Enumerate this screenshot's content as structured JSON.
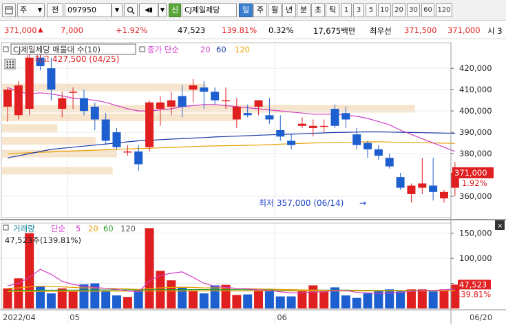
{
  "toolbar": {
    "interval_label": "주",
    "prev_label": "전",
    "stock_code": "097950",
    "badge_label": "신",
    "stock_name": "CJ제일제당",
    "period_tabs": [
      "일",
      "주",
      "월",
      "년",
      "분",
      "초",
      "틱"
    ],
    "active_period": "일",
    "period_numbers": [
      "1",
      "3",
      "5",
      "10",
      "20",
      "30",
      "60",
      "120"
    ]
  },
  "quote": {
    "price": "371,000",
    "arrow": "▲",
    "change": "7,000",
    "change_pct": "+1.92%",
    "volume": "47,523",
    "volume_ratio": "139.81%",
    "turnover_pct": "0.32%",
    "amount": "17,675백만",
    "best_ask_label": "최우선",
    "best_ask": "371,500",
    "best_bid": "371,000",
    "trailing": "시 3"
  },
  "price_panel": {
    "indicator_name": "CJ제일제당 매물대 수(10)",
    "ma_label": "종가 단순",
    "ma_periods": [
      "20",
      "60",
      "120"
    ],
    "high_annotation": "←최고 427,500 (04/25)",
    "low_annotation": "최저 357,000 (06/14)",
    "low_arrow": "→",
    "price_tag": "371,000",
    "pct_tag": "1.92%",
    "y_ticks": [
      "420,000",
      "410,000",
      "400,000",
      "390,000",
      "380,000",
      "360,000"
    ]
  },
  "volume_panel": {
    "title": "거래량",
    "ma_label": "단순",
    "ma_periods": [
      "5",
      "20",
      "60",
      "120"
    ],
    "readout": "47,523주(139.81%)",
    "y_ticks": [
      "150,000",
      "100,000",
      "50,000"
    ],
    "tag_volume": "47,523",
    "tag_pct": "139.81%"
  },
  "x_axis": {
    "labels": [
      "2022/04",
      "05",
      "06",
      "06/20"
    ]
  },
  "colors": {
    "up": "#e02020",
    "down": "#1e5fd0",
    "ma20": "#d23cc8",
    "ma60": "#1e3aa8",
    "ma120": "#e8a000",
    "volume_profile": "#f7e4cc"
  },
  "chart_data": {
    "type": "candlestick",
    "price_range": [
      350000,
      432000
    ],
    "candles": [
      {
        "o": 402000,
        "h": 411000,
        "l": 395000,
        "c": 410000
      },
      {
        "o": 398000,
        "h": 414000,
        "l": 396000,
        "c": 412000
      },
      {
        "o": 401000,
        "h": 427500,
        "l": 398000,
        "c": 425000
      },
      {
        "o": 425000,
        "h": 427000,
        "l": 419000,
        "c": 421000
      },
      {
        "o": 420000,
        "h": 425000,
        "l": 405000,
        "c": 410000
      },
      {
        "o": 401000,
        "h": 409000,
        "l": 397000,
        "c": 406000
      },
      {
        "o": 409000,
        "h": 411000,
        "l": 401000,
        "c": 409000
      },
      {
        "o": 406000,
        "h": 410000,
        "l": 398000,
        "c": 400000
      },
      {
        "o": 402000,
        "h": 404000,
        "l": 391000,
        "c": 396000
      },
      {
        "o": 396000,
        "h": 399000,
        "l": 384000,
        "c": 386000
      },
      {
        "o": 390000,
        "h": 392000,
        "l": 382000,
        "c": 383000
      },
      {
        "o": 381000,
        "h": 384000,
        "l": 379000,
        "c": 381000
      },
      {
        "o": 381000,
        "h": 384000,
        "l": 372000,
        "c": 375000
      },
      {
        "o": 383000,
        "h": 405000,
        "l": 381000,
        "c": 404000
      },
      {
        "o": 401000,
        "h": 407000,
        "l": 393000,
        "c": 404000
      },
      {
        "o": 402000,
        "h": 409000,
        "l": 398000,
        "c": 405000
      },
      {
        "o": 407000,
        "h": 412000,
        "l": 397000,
        "c": 402000
      },
      {
        "o": 410000,
        "h": 415000,
        "l": 404000,
        "c": 412000
      },
      {
        "o": 411000,
        "h": 414000,
        "l": 401000,
        "c": 409000
      },
      {
        "o": 409000,
        "h": 411000,
        "l": 403000,
        "c": 405000
      },
      {
        "o": 405000,
        "h": 411000,
        "l": 401000,
        "c": 405000
      },
      {
        "o": 396000,
        "h": 406000,
        "l": 392000,
        "c": 402000
      },
      {
        "o": 399000,
        "h": 403000,
        "l": 397000,
        "c": 398000
      },
      {
        "o": 402000,
        "h": 405000,
        "l": 398000,
        "c": 405000
      },
      {
        "o": 398000,
        "h": 406000,
        "l": 394000,
        "c": 396000
      },
      {
        "o": 391000,
        "h": 398000,
        "l": 386000,
        "c": 388000
      },
      {
        "o": 386000,
        "h": 389000,
        "l": 382000,
        "c": 384000
      },
      {
        "o": 393000,
        "h": 397000,
        "l": 392000,
        "c": 394000
      },
      {
        "o": 392000,
        "h": 396000,
        "l": 388000,
        "c": 393000
      },
      {
        "o": 393000,
        "h": 396000,
        "l": 390000,
        "c": 393000
      },
      {
        "o": 401000,
        "h": 403000,
        "l": 392000,
        "c": 393000
      },
      {
        "o": 399000,
        "h": 402000,
        "l": 392000,
        "c": 396000
      },
      {
        "o": 389000,
        "h": 392000,
        "l": 382000,
        "c": 384000
      },
      {
        "o": 385000,
        "h": 386000,
        "l": 378000,
        "c": 382000
      },
      {
        "o": 382000,
        "h": 384000,
        "l": 377000,
        "c": 379000
      },
      {
        "o": 378000,
        "h": 380000,
        "l": 373000,
        "c": 374000
      },
      {
        "o": 369000,
        "h": 371000,
        "l": 363000,
        "c": 364000
      },
      {
        "o": 361000,
        "h": 366000,
        "l": 357000,
        "c": 365000
      },
      {
        "o": 364000,
        "h": 378000,
        "l": 361000,
        "c": 366000
      },
      {
        "o": 365000,
        "h": 378000,
        "l": 358000,
        "c": 362000
      },
      {
        "o": 359000,
        "h": 363000,
        "l": 357000,
        "c": 362000
      },
      {
        "o": 364000,
        "h": 376000,
        "l": 360000,
        "c": 371000
      }
    ],
    "ma20": [
      411000,
      409000,
      408000,
      408500,
      408000,
      407000,
      406000,
      405500,
      405000,
      404000,
      402500,
      401000,
      400000,
      400000,
      400500,
      401000,
      402000,
      402500,
      403000,
      403000,
      402500,
      402000,
      401500,
      401000,
      400500,
      400000,
      399500,
      399000,
      398500,
      398500,
      398500,
      398000,
      397500,
      396500,
      395000,
      393500,
      391000,
      389000,
      387000,
      385000,
      383000,
      381000
    ],
    "ma60": [
      378000,
      379000,
      380000,
      381000,
      382000,
      382500,
      383000,
      383500,
      384000,
      384500,
      385000,
      385500,
      386000,
      386200,
      386500,
      386800,
      387000,
      387300,
      387500,
      387800,
      388000,
      388200,
      388400,
      388600,
      388800,
      389000,
      389100,
      389300,
      389500,
      389700,
      389900,
      390000,
      390100,
      390200,
      390200,
      390100,
      390000,
      389900,
      389800,
      389700,
      389600,
      389500
    ],
    "ma120": [
      380000,
      380200,
      380400,
      380600,
      380800,
      381000,
      381200,
      381400,
      381600,
      381800,
      382000,
      382200,
      382400,
      382500,
      382700,
      382900,
      383100,
      383300,
      383500,
      383600,
      383700,
      383800,
      383900,
      384000,
      384200,
      384400,
      384600,
      384800,
      385000,
      385100,
      385200,
      385300,
      385400,
      385500,
      385500,
      385400,
      385300,
      385200,
      385100,
      385000,
      384900,
      384800
    ],
    "volume_profile": [
      {
        "price": 411000,
        "length": 0.48
      },
      {
        "price": 401000,
        "length": 0.97
      },
      {
        "price": 397000,
        "length": 0.55
      },
      {
        "price": 392000,
        "length": 0.13
      },
      {
        "price": 386000,
        "length": 0.22
      },
      {
        "price": 380000,
        "length": 0.27
      },
      {
        "price": 372000,
        "length": 0.26
      }
    ],
    "volume_range": [
      0,
      170000
    ],
    "volumes": [
      40000,
      60000,
      150000,
      45000,
      30000,
      40000,
      35000,
      48000,
      50000,
      35000,
      26000,
      23000,
      38000,
      160000,
      75000,
      56000,
      43000,
      36000,
      30000,
      46000,
      47000,
      27000,
      28000,
      36000,
      38000,
      24000,
      24000,
      35000,
      46000,
      34000,
      42000,
      26000,
      21000,
      30000,
      36000,
      38000,
      34000,
      38000,
      38000,
      34000,
      38000,
      47523
    ],
    "vol_ma5": [
      45000,
      50000,
      62000,
      78000,
      68000,
      54000,
      48000,
      44000,
      42000,
      40000,
      38000,
      35000,
      33000,
      55000,
      66000,
      70000,
      73000,
      62000,
      50000,
      44000,
      42000,
      40000,
      39000,
      37000,
      36000,
      33000,
      31000,
      31000,
      33000,
      33000,
      36000,
      36000,
      32000,
      31000,
      30000,
      31000,
      32000,
      34000,
      36000,
      36000,
      37000,
      39000
    ],
    "vol_ma20": [
      40000,
      41000,
      43000,
      44000,
      44000,
      43000,
      42000,
      41000,
      41000,
      40000,
      40000,
      39000,
      38000,
      40000,
      41000,
      42000,
      42000,
      42000,
      41000,
      41000,
      41000,
      40000,
      39500,
      39000,
      38500,
      38000,
      37500,
      37000,
      36500,
      36000,
      36000,
      35800,
      35600,
      35500,
      35400,
      35300,
      35200,
      35200,
      35200,
      35300,
      35400,
      35600
    ],
    "vol_ma60": [
      36000,
      36100,
      36200,
      36300,
      36400,
      36500,
      36600,
      36700,
      36800,
      36900,
      37000,
      37100,
      37200,
      37300,
      37400,
      37500,
      37500,
      37500,
      37500,
      37500,
      37500,
      37400,
      37300,
      37200,
      37100,
      37000,
      36900,
      36800,
      36700,
      36600,
      36500,
      36400,
      36300,
      36200,
      36100,
      36000,
      35900,
      35800,
      35700,
      35600,
      35500,
      35400
    ],
    "vol_ma120": [
      34000,
      34050,
      34100,
      34150,
      34200,
      34250,
      34300,
      34350,
      34400,
      34450,
      34500,
      34550,
      34600,
      34650,
      34700,
      34750,
      34800,
      34850,
      34900,
      34950,
      35000,
      35000,
      35000,
      35000,
      35000,
      35000,
      35000,
      35000,
      35000,
      35000,
      35000,
      35000,
      35000,
      35000,
      35000,
      35000,
      35000,
      35000,
      35000,
      35000,
      35000,
      35000
    ],
    "month_boundaries": [
      {
        "label": "05",
        "index": 6
      },
      {
        "label": "06",
        "index": 25
      }
    ]
  }
}
